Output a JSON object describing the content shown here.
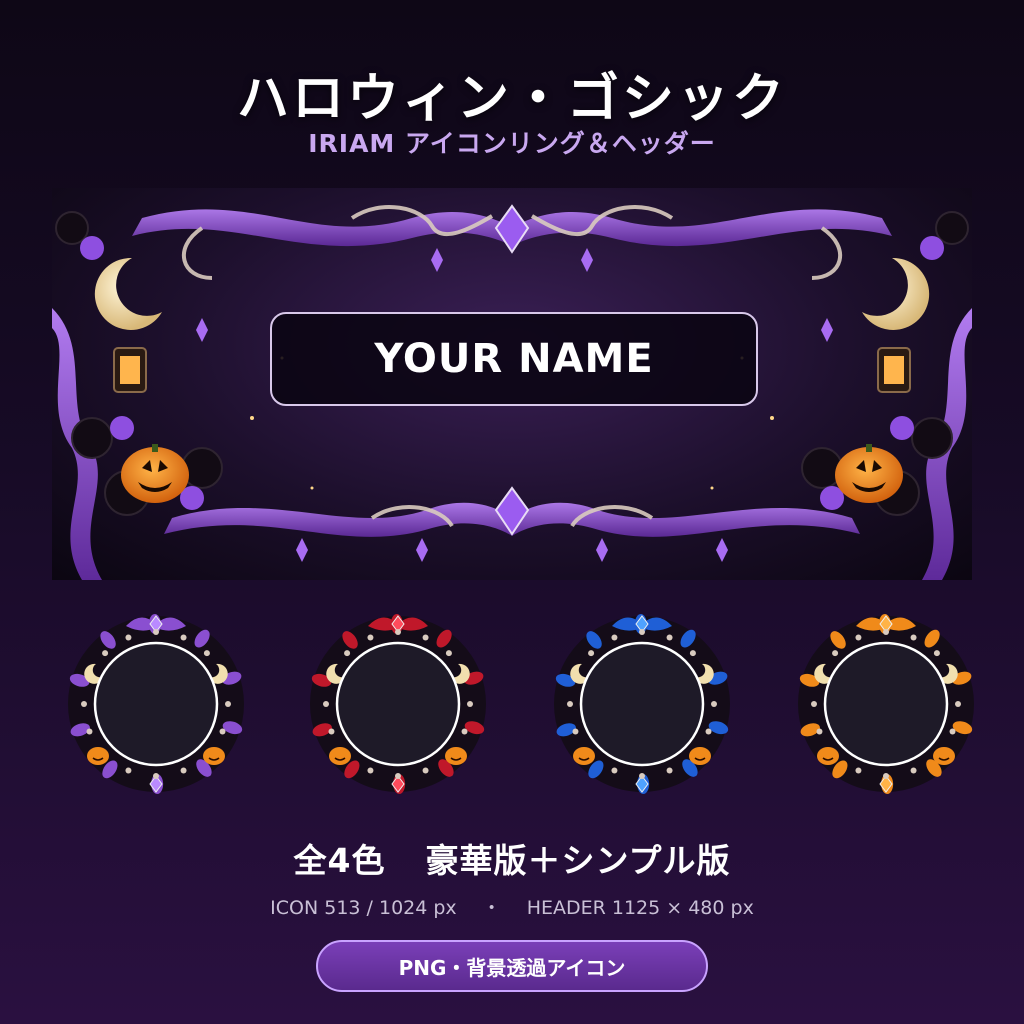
{
  "title": "ハロウィン・ゴシック",
  "subtitle": "IRIAM アイコンリング＆ヘッダー",
  "header": {
    "name_placeholder": "YOUR NAME"
  },
  "icon_rings": [
    {
      "color_name": "purple",
      "ribbon_color": "#8a4fd0",
      "accent_color": "#b98aff"
    },
    {
      "color_name": "red",
      "ribbon_color": "#c0182a",
      "accent_color": "#ff4b5c"
    },
    {
      "color_name": "blue",
      "ribbon_color": "#1f5fd6",
      "accent_color": "#4fa2ff"
    },
    {
      "color_name": "orange",
      "ribbon_color": "#f08a1a",
      "accent_color": "#ffb347"
    }
  ],
  "caption": {
    "colors": "全4色",
    "editions": "豪華版＋シンプル版"
  },
  "specs": {
    "icon": "ICON 513 / 1024 px",
    "separator": "・",
    "header": "HEADER 1125 × 480 px"
  },
  "button": {
    "label": "PNG・背景透過アイコン"
  },
  "colors": {
    "background_top": "#0e0716",
    "background_bottom": "#2a1040",
    "subtitle": "#c9a8f0",
    "ribbon_purple": "#8a4fd0",
    "pumpkin": "#f08a1a",
    "button": "#6a33a3"
  }
}
